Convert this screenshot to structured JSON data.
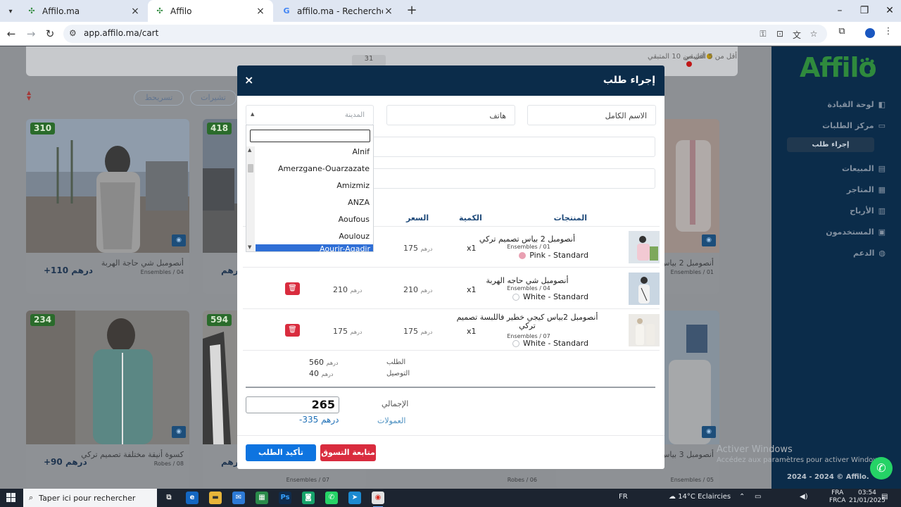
{
  "browser": {
    "tabs": [
      {
        "title": "Affilo.ma",
        "active": false
      },
      {
        "title": "Affilo",
        "active": true
      },
      {
        "title": "affilo.ma - Recherche Google",
        "active": false
      }
    ],
    "url": "app.affilo.ma/cart"
  },
  "page": {
    "top_count": "31",
    "top_legend": [
      {
        "text": "أقل من 5 المتبقي",
        "color": "#c01818"
      },
      {
        "text": "أقل من 10 المتبقي",
        "color": "#b8920c"
      }
    ],
    "filters": [
      "تشيرات",
      "تشيرات",
      "تسريحط"
    ],
    "cards_row1": [
      {
        "badge": "310",
        "name": "أنصومبل شي حاجة الهربة",
        "category": "Ensembles / 04",
        "price": "+110 درهم"
      },
      {
        "badge": "418",
        "name": "",
        "category": "",
        "price": "درهم"
      },
      {
        "badge": "",
        "name": "أنصومبل 2 بياس",
        "category": "Ensembles / 01",
        "price": ""
      }
    ],
    "cards_row2": [
      {
        "badge": "234",
        "name": "كسوة أنيقة مختلفة تصميم تركي",
        "category": "Robes / 08",
        "price": "+90 درهم"
      },
      {
        "badge": "594",
        "name": "",
        "category": "Ensembles / 07",
        "price": "درهم"
      },
      {
        "badge": "",
        "name": "",
        "category": "Robes / 06",
        "price": ""
      },
      {
        "badge": "",
        "name": "أنصومبل 3 بياس مختلفة",
        "category": "Ensembles / 05",
        "price": ""
      }
    ]
  },
  "sidebar": {
    "logo": "Affilo",
    "items": [
      {
        "label": "لوحة القيادة",
        "icon": "dashboard-icon"
      },
      {
        "label": "مركز الطلبات",
        "icon": "orders-icon"
      },
      {
        "label": "المبيعات",
        "icon": "sales-icon"
      },
      {
        "label": "المتاجر",
        "icon": "store-icon"
      },
      {
        "label": "الأرباح",
        "icon": "profit-icon"
      },
      {
        "label": "المستخدمون",
        "icon": "users-icon"
      },
      {
        "label": "الدعم",
        "icon": "support-icon"
      }
    ],
    "sub_item": "إجراء طلب",
    "footer": "2024 - 2024 © Affilo."
  },
  "watermark": {
    "title": "Activer Windows",
    "subtitle": "Accédez aux paramètres pour activer Windows."
  },
  "modal": {
    "title": "إجراء طلب",
    "close": "×",
    "fields": {
      "full_name": "الاسم الكامل",
      "phone": "هاتف",
      "city": "المدينة"
    },
    "columns": {
      "products": "المنتجات",
      "quantity": "الكمية",
      "price": "السعر"
    },
    "currency": "درهم",
    "rows": [
      {
        "name": "أنصومبل 2 بياس تصميم تركي",
        "category": "Ensembles / 01",
        "variant": "Pink - Standard",
        "swatch": "#e9a0b2",
        "qty": "x1",
        "unit": "175",
        "subtotal": ""
      },
      {
        "name": "أنصومبل شي حاجه الهربة",
        "category": "Ensembles / 04",
        "variant": "White - Standard",
        "swatch": "#ffffff",
        "qty": "x1",
        "unit": "210",
        "subtotal": "210"
      },
      {
        "name": "أنصومبل  2بياس كيجي خطير فاللبسة تصميم تركي",
        "category": "Ensembles / 07",
        "variant": "White - Standard",
        "swatch": "#ffffff",
        "qty": "x1",
        "unit": "175",
        "subtotal": "175"
      }
    ],
    "summary": {
      "order_label": "الطلب",
      "order_value": "560",
      "delivery_label": "التوصيل",
      "delivery_value": "40",
      "total_label": "الإجمالي",
      "total_value": "265",
      "commission_label": "العمولات",
      "commission_value": "-335 درهم"
    },
    "buttons": {
      "confirm": "تأكيد الطلب",
      "continue": "متابعة التسوق"
    }
  },
  "dropdown": {
    "search_value": "",
    "options": [
      "Alnif",
      "Amerzgane-Ouarzazate",
      "Amizmiz",
      "ANZA",
      "Aoufous",
      "Aoulouz"
    ],
    "highlighted": "Aourir-Agadir"
  },
  "taskbar": {
    "search_placeholder": "Taper ici pour rechercher",
    "weather": "14°C  Eclaircies",
    "lang": "FRA",
    "lang_sub": "FRCA",
    "keyboard": "FR",
    "time": "03:54",
    "date": "21/01/2025",
    "mail_badge": "25"
  }
}
